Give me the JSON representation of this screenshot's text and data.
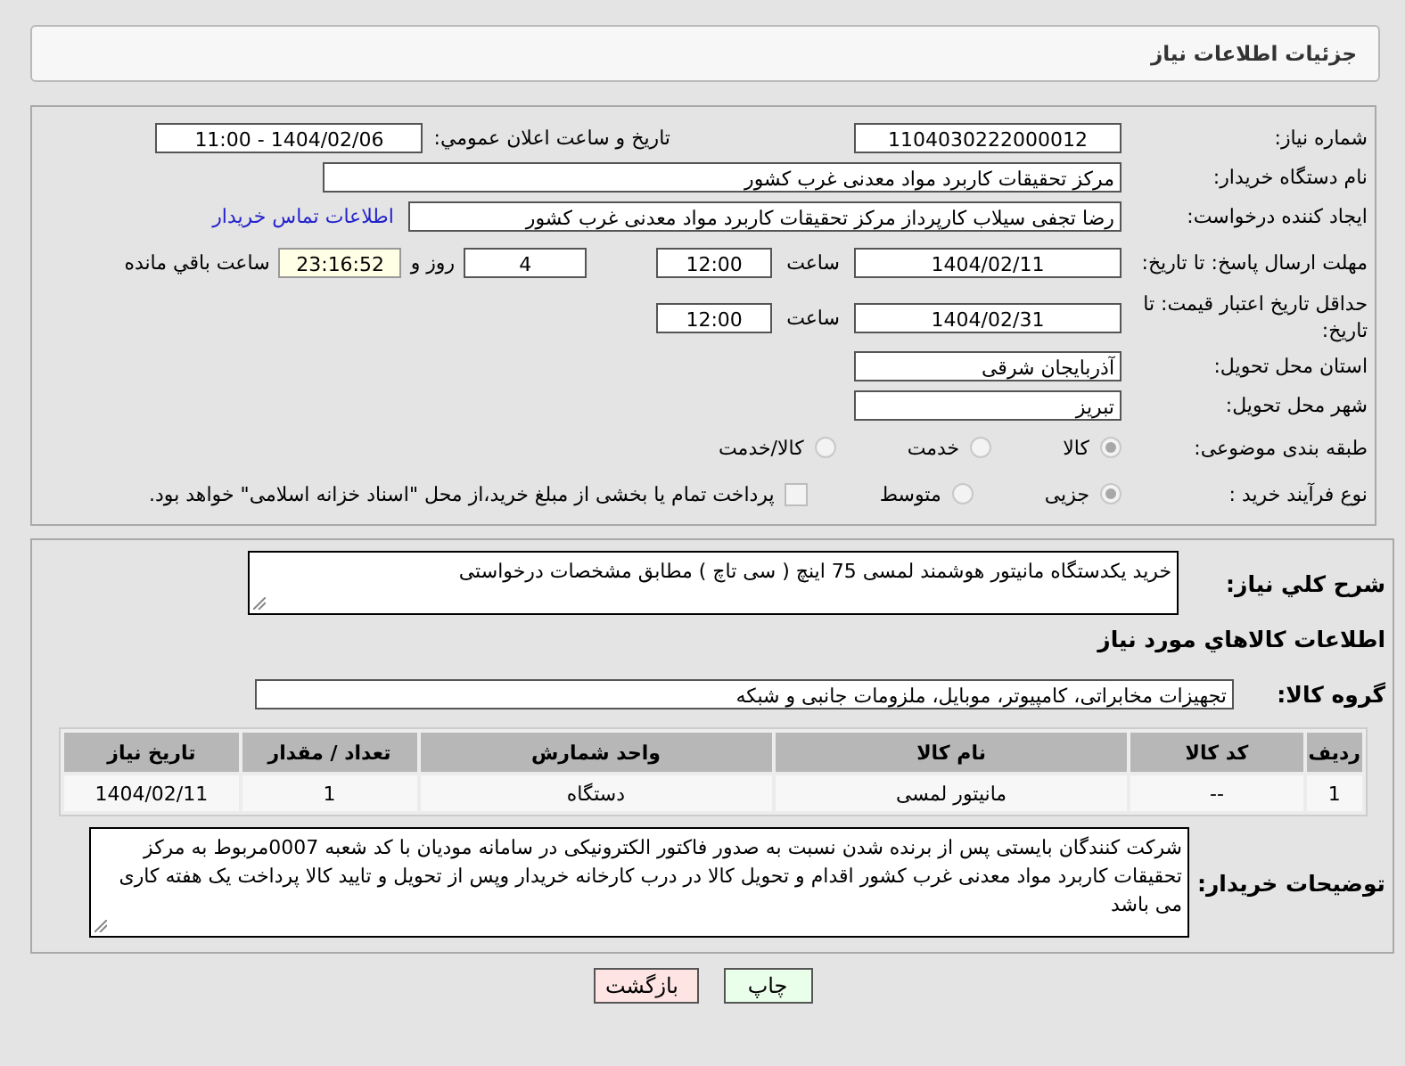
{
  "header": {
    "title": "جزئیات اطلاعات نیاز"
  },
  "need_number": {
    "label": "شماره نیاز:",
    "value": "1104030222000012"
  },
  "announce": {
    "label": "تاریخ و ساعت اعلان عمومي:",
    "value": "1404/02/06 - 11:00"
  },
  "buyer_org": {
    "label": "نام دستگاه خریدار:",
    "value": "مرکز تحقیقات کاربرد مواد معدنی غرب کشور"
  },
  "creator": {
    "label": "ایجاد کننده درخواست:",
    "value": "رضا تجفی سیلاب کارپرداز مرکز تحقیقات کاربرد مواد معدنی غرب کشور",
    "link": "اطلاعات تماس خریدار"
  },
  "deadline": {
    "label": "مهلت ارسال پاسخ: تا تاریخ:",
    "date": "1404/02/11",
    "time_label": "ساعت",
    "time": "12:00",
    "days": "4",
    "days_label": "روز و",
    "remaining": "23:16:52",
    "remaining_label": "ساعت باقي مانده"
  },
  "validity": {
    "label": "حداقل تاریخ اعتبار قیمت: تا تاریخ:",
    "date": "1404/02/31",
    "time_label": "ساعت",
    "time": "12:00"
  },
  "province": {
    "label": "استان محل تحویل:",
    "value": "آذربایجان شرقی"
  },
  "city": {
    "label": "شهر محل تحویل:",
    "value": "تبریز"
  },
  "category": {
    "label": "طبقه بندی موضوعی:",
    "options": [
      {
        "label": "کالا",
        "selected": true
      },
      {
        "label": "خدمت",
        "selected": false
      },
      {
        "label": "کالا/خدمت",
        "selected": false
      }
    ]
  },
  "process": {
    "label": "نوع فرآیند خرید :",
    "options": [
      {
        "label": "جزیی",
        "selected": true
      },
      {
        "label": "متوسط",
        "selected": false
      }
    ],
    "treasury": {
      "label": "پرداخت تمام یا بخشی از مبلغ خرید،از محل \"اسناد خزانه اسلامی\" خواهد بود.",
      "checked": false
    }
  },
  "description": {
    "label": "شرح کلي نیاز:",
    "value": "خرید یکدستگاه مانیتور هوشمند لمسی 75 اینچ ( سی تاچ ) مطابق مشخصات درخواستی"
  },
  "goods_title": "اطلاعات کالاهاي مورد نیاز",
  "goods_group": {
    "label": "گروه کالا:",
    "value": "تجهیزات مخابراتی، کامپیوتر، موبایل، ملزومات جانبی و شبکه"
  },
  "table": {
    "columns": [
      "ردیف",
      "کد کالا",
      "نام کالا",
      "واحد شمارش",
      "تعداد / مقدار",
      "تاریخ نیاز"
    ],
    "rows": [
      [
        "1",
        "--",
        "مانیتور لمسی",
        "دستگاه",
        "1",
        "1404/02/11"
      ]
    ]
  },
  "notes": {
    "label": "توضیحات خریدار:",
    "value": "شرکت کنندگان بایستی پس از برنده شدن نسبت به صدور فاکتور الکترونیکی در سامانه مودیان با کد شعبه 0007مربوط به مرکز تحقیقات کاربرد مواد معدنی غرب کشور اقدام و تحویل کالا در درب کارخانه خریدار  وپس از تحویل و تایید کالا پرداخت یک هفته کاری می باشد"
  },
  "buttons": [
    {
      "label": "چاپ",
      "kind": "print"
    },
    {
      "label": "بازگشت",
      "kind": "back"
    }
  ]
}
